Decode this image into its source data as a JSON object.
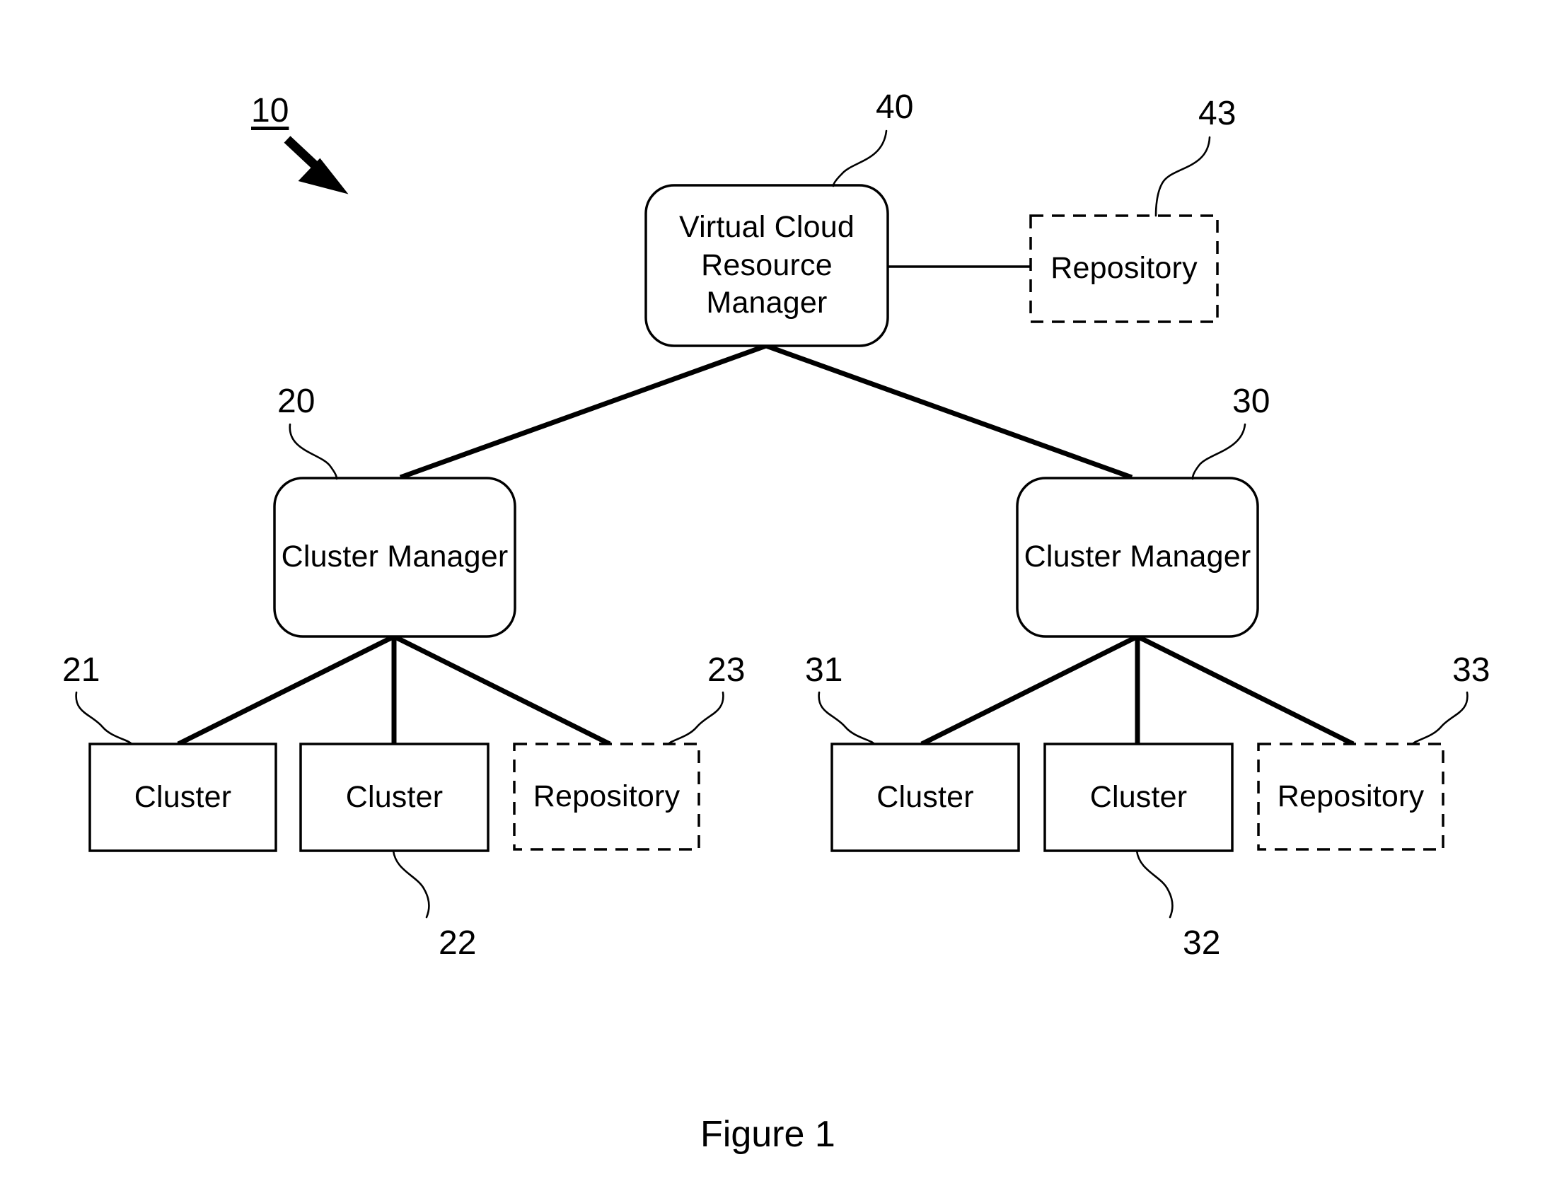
{
  "figure": {
    "caption": "Figure 1",
    "system_ref": "10"
  },
  "nodes": [
    {
      "id": "vcrm",
      "label": "Virtual Cloud\nResource\nManager",
      "ref": "40",
      "shape": "rounded-rect",
      "border": "solid"
    },
    {
      "id": "repository-top",
      "label": "Repository",
      "ref": "43",
      "shape": "rect",
      "border": "dashed"
    },
    {
      "id": "cluster-manager-left",
      "label": "Cluster Manager",
      "ref": "20",
      "shape": "rounded-rect",
      "border": "solid"
    },
    {
      "id": "cluster-manager-right",
      "label": "Cluster Manager",
      "ref": "30",
      "shape": "rounded-rect",
      "border": "solid"
    },
    {
      "id": "cluster-21",
      "label": "Cluster",
      "ref": "21",
      "shape": "rect",
      "border": "solid"
    },
    {
      "id": "cluster-22",
      "label": "Cluster",
      "ref": "22",
      "shape": "rect",
      "border": "solid"
    },
    {
      "id": "repository-23",
      "label": "Repository",
      "ref": "23",
      "shape": "rect",
      "border": "dashed"
    },
    {
      "id": "cluster-31",
      "label": "Cluster",
      "ref": "31",
      "shape": "rect",
      "border": "solid"
    },
    {
      "id": "cluster-32",
      "label": "Cluster",
      "ref": "32",
      "shape": "rect",
      "border": "solid"
    },
    {
      "id": "repository-33",
      "label": "Repository",
      "ref": "33",
      "shape": "rect",
      "border": "dashed"
    }
  ],
  "colors": {
    "stroke": "#000000",
    "background": "#ffffff",
    "text": "#000000"
  }
}
